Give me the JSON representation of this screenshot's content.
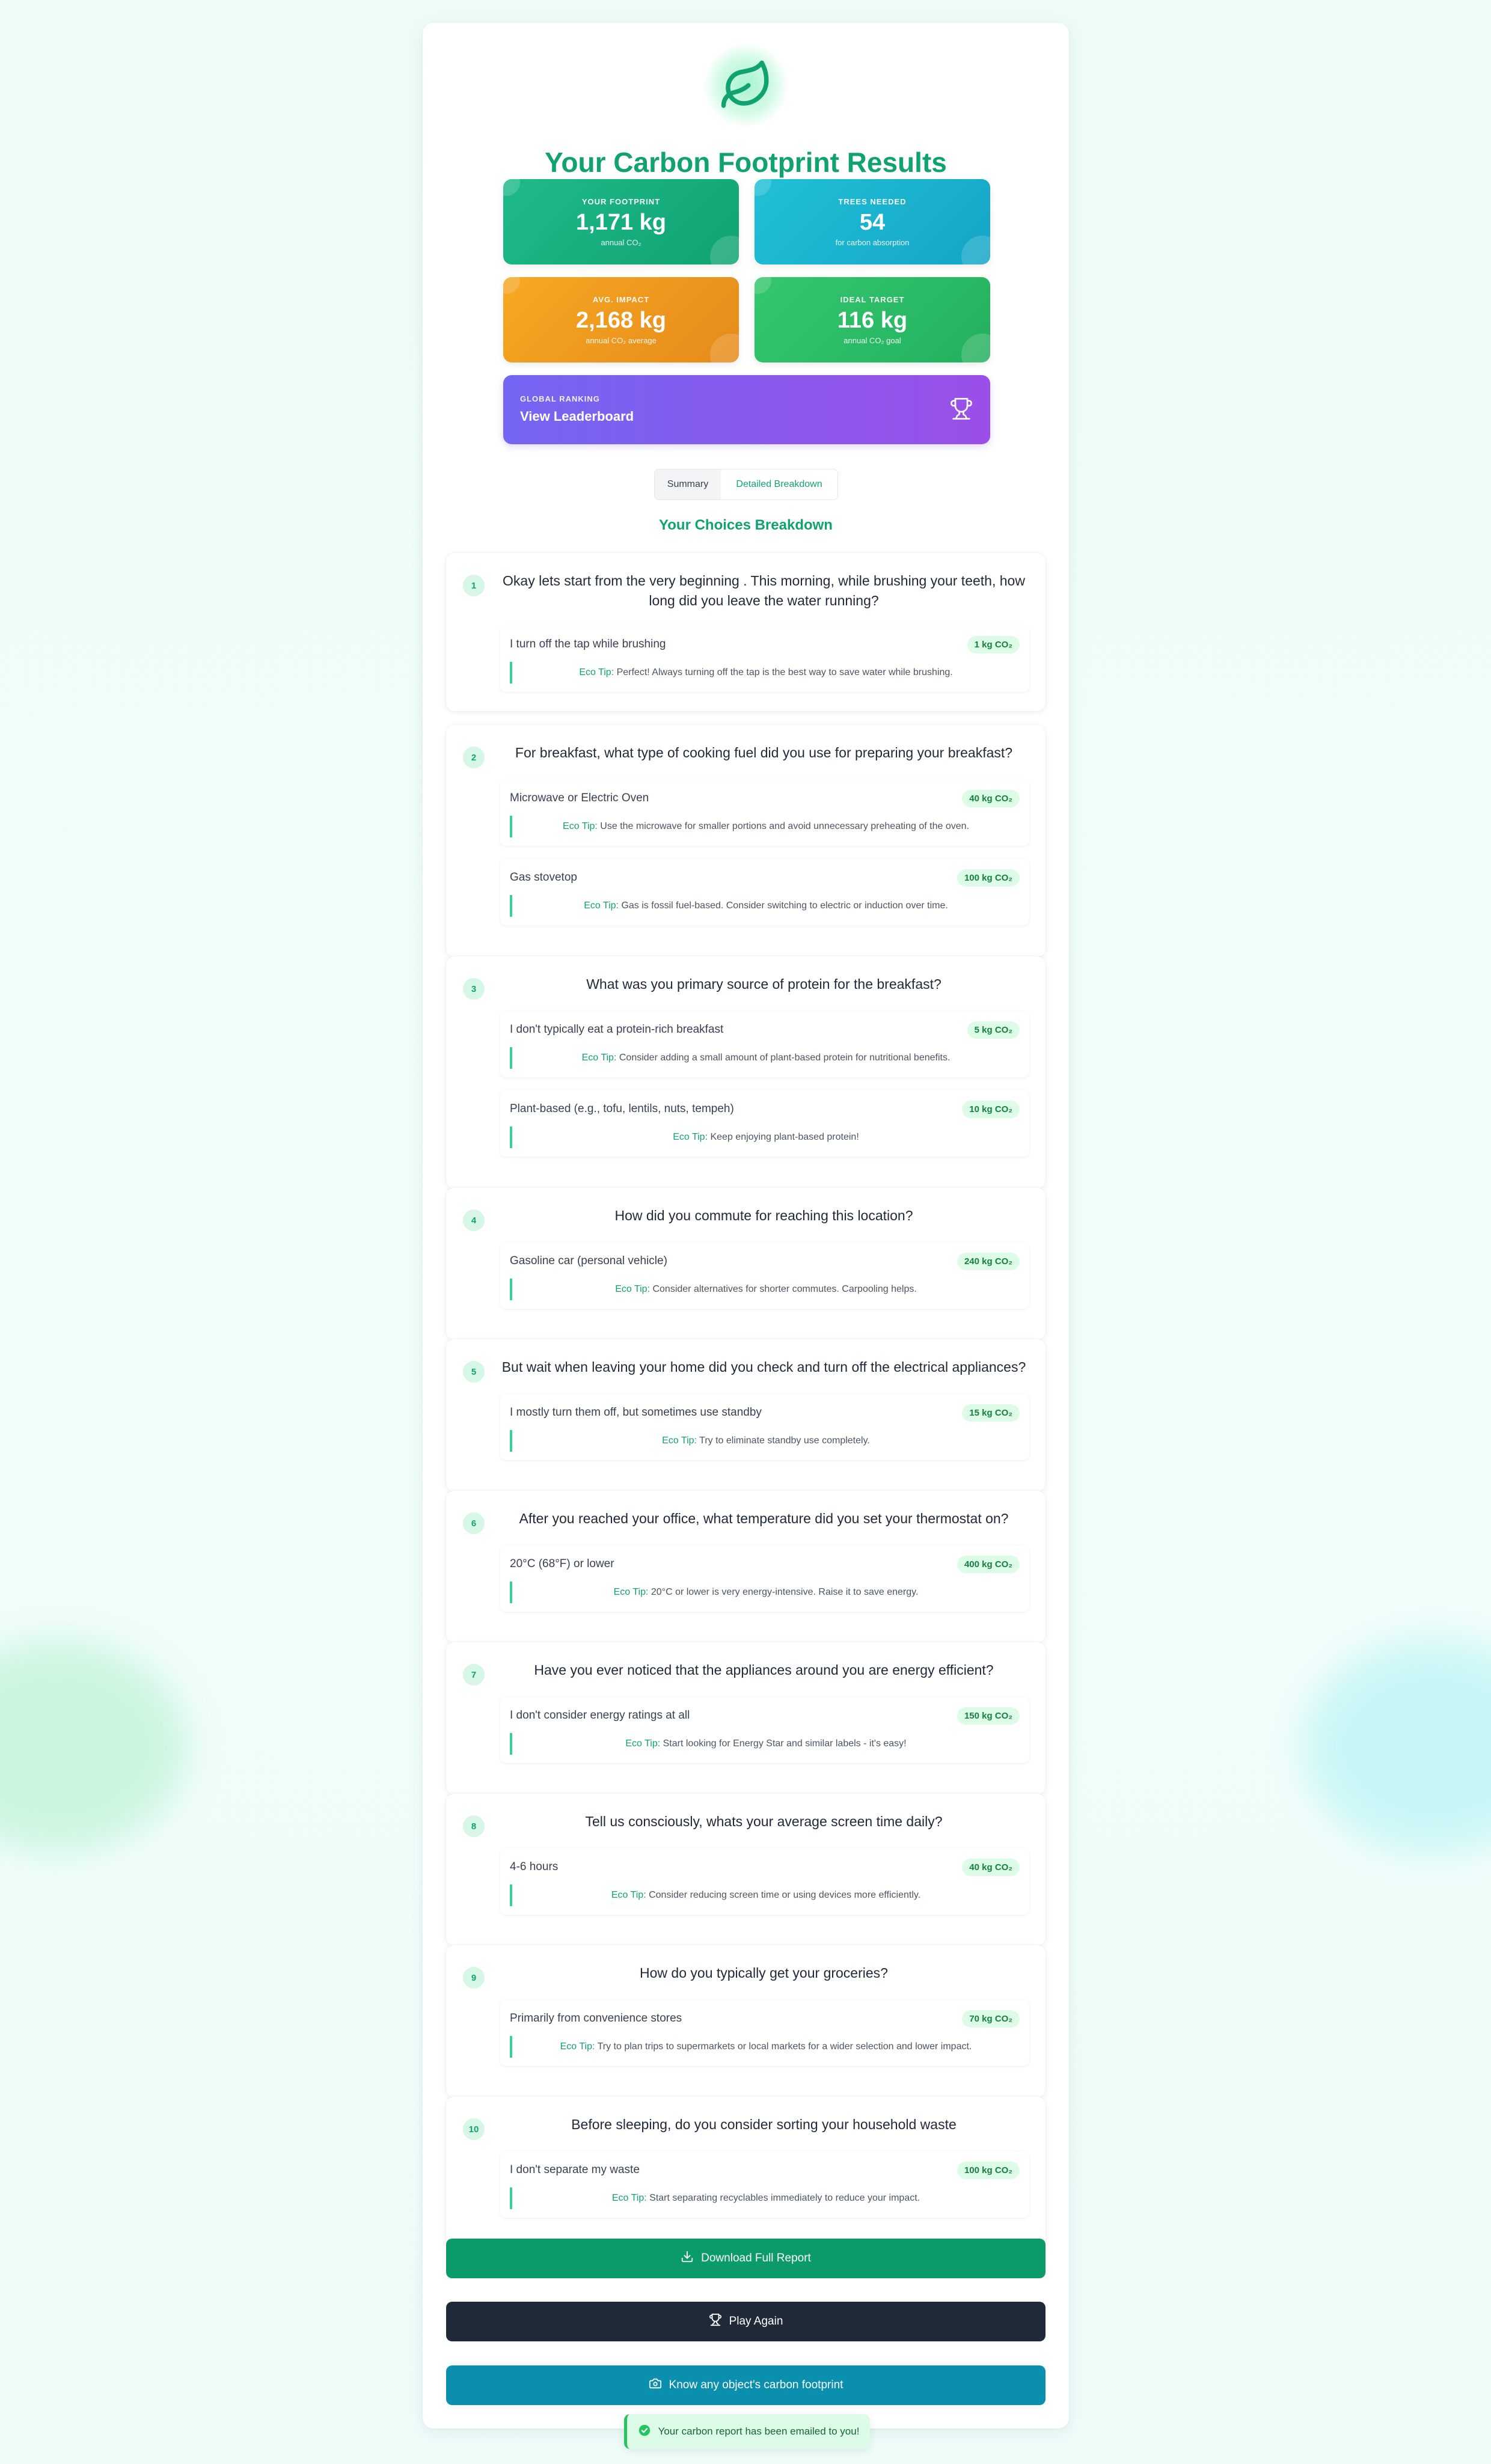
{
  "header": {
    "title": "Your Carbon Footprint Results"
  },
  "stats": [
    {
      "label": "YOUR FOOTPRINT",
      "value": "1,171 kg",
      "sub": "annual CO₂"
    },
    {
      "label": "TREES NEEDED",
      "value": "54",
      "sub": "for carbon absorption"
    },
    {
      "label": "AVG. IMPACT",
      "value": "2,168 kg",
      "sub": "annual CO₂ average"
    },
    {
      "label": "IDEAL TARGET",
      "value": "116 kg",
      "sub": "annual CO₂ goal"
    }
  ],
  "leaderboard": {
    "label": "GLOBAL RANKING",
    "title": "View Leaderboard",
    "icon": "trophy-icon"
  },
  "tabs": {
    "summary": "Summary",
    "detailed": "Detailed Breakdown",
    "active": "detailed"
  },
  "section_title": "Your Choices Breakdown",
  "eco_label": "Eco Tip:",
  "questions": [
    {
      "num": "1",
      "text": "Okay lets start from the very beginning . This morning, while brushing your teeth, how long did you leave the water running?",
      "answers": [
        {
          "text": "I turn off the tap while brushing",
          "co2": "1 kg CO₂",
          "tip": "Perfect! Always turning off the tap is the best way to save water while brushing."
        }
      ]
    },
    {
      "num": "2",
      "text": "For breakfast, what type of cooking fuel did you use for preparing your breakfast?",
      "answers": [
        {
          "text": "Microwave or Electric Oven",
          "co2": "40 kg CO₂",
          "tip": "Use the microwave for smaller portions and avoid unnecessary preheating of the oven."
        },
        {
          "text": "Gas stovetop",
          "co2": "100 kg CO₂",
          "tip": "Gas is fossil fuel-based. Consider switching to electric or induction over time."
        }
      ]
    },
    {
      "num": "3",
      "text": "What was you primary source of protein for the breakfast?",
      "answers": [
        {
          "text": "I don't typically eat a protein-rich breakfast",
          "co2": "5 kg CO₂",
          "tip": "Consider adding a small amount of plant-based protein for nutritional benefits."
        },
        {
          "text": "Plant-based (e.g., tofu, lentils, nuts, tempeh)",
          "co2": "10 kg CO₂",
          "tip": "Keep enjoying plant-based protein!"
        }
      ]
    },
    {
      "num": "4",
      "text": "How did you commute for reaching this location?",
      "answers": [
        {
          "text": "Gasoline car (personal vehicle)",
          "co2": "240 kg CO₂",
          "tip": "Consider alternatives for shorter commutes. Carpooling helps."
        }
      ]
    },
    {
      "num": "5",
      "text": "But wait when leaving your home did you check and turn off the electrical appliances?",
      "answers": [
        {
          "text": "I mostly turn them off, but sometimes use standby",
          "co2": "15 kg CO₂",
          "tip": "Try to eliminate standby use completely."
        }
      ]
    },
    {
      "num": "6",
      "text": "After you reached your office, what temperature did you set your thermostat on?",
      "answers": [
        {
          "text": "20°C (68°F) or lower",
          "co2": "400 kg CO₂",
          "tip": "20°C or lower is very energy-intensive. Raise it to save energy."
        }
      ]
    },
    {
      "num": "7",
      "text": "Have you ever noticed that the appliances around you are energy efficient?",
      "answers": [
        {
          "text": "I don't consider energy ratings at all",
          "co2": "150 kg CO₂",
          "tip": "Start looking for Energy Star and similar labels - it's easy!"
        }
      ]
    },
    {
      "num": "8",
      "text": "Tell us consciously, whats your average screen time daily?",
      "answers": [
        {
          "text": "4-6 hours",
          "co2": "40 kg CO₂",
          "tip": "Consider reducing screen time or using devices more efficiently."
        }
      ]
    },
    {
      "num": "9",
      "text": "How do you typically get your groceries?",
      "answers": [
        {
          "text": "Primarily from convenience stores",
          "co2": "70 kg CO₂",
          "tip": "Try to plan trips to supermarkets or local markets for a wider selection and lower impact."
        }
      ]
    },
    {
      "num": "10",
      "text": "Before sleeping, do you consider sorting your household waste",
      "answers": [
        {
          "text": "I don't separate my waste",
          "co2": "100 kg CO₂",
          "tip": "Start separating recyclables immediately to reduce your impact."
        }
      ]
    }
  ],
  "buttons": {
    "download": "Download Full Report",
    "play_again": "Play Again",
    "know_object": "Know any object's carbon footprint"
  },
  "toast": "Your carbon report has been emailed to you!",
  "colors": {
    "accent": "#10a371",
    "leaderboard": "#8b5cf6",
    "play": "#1f2937",
    "object": "#0b8fae"
  }
}
